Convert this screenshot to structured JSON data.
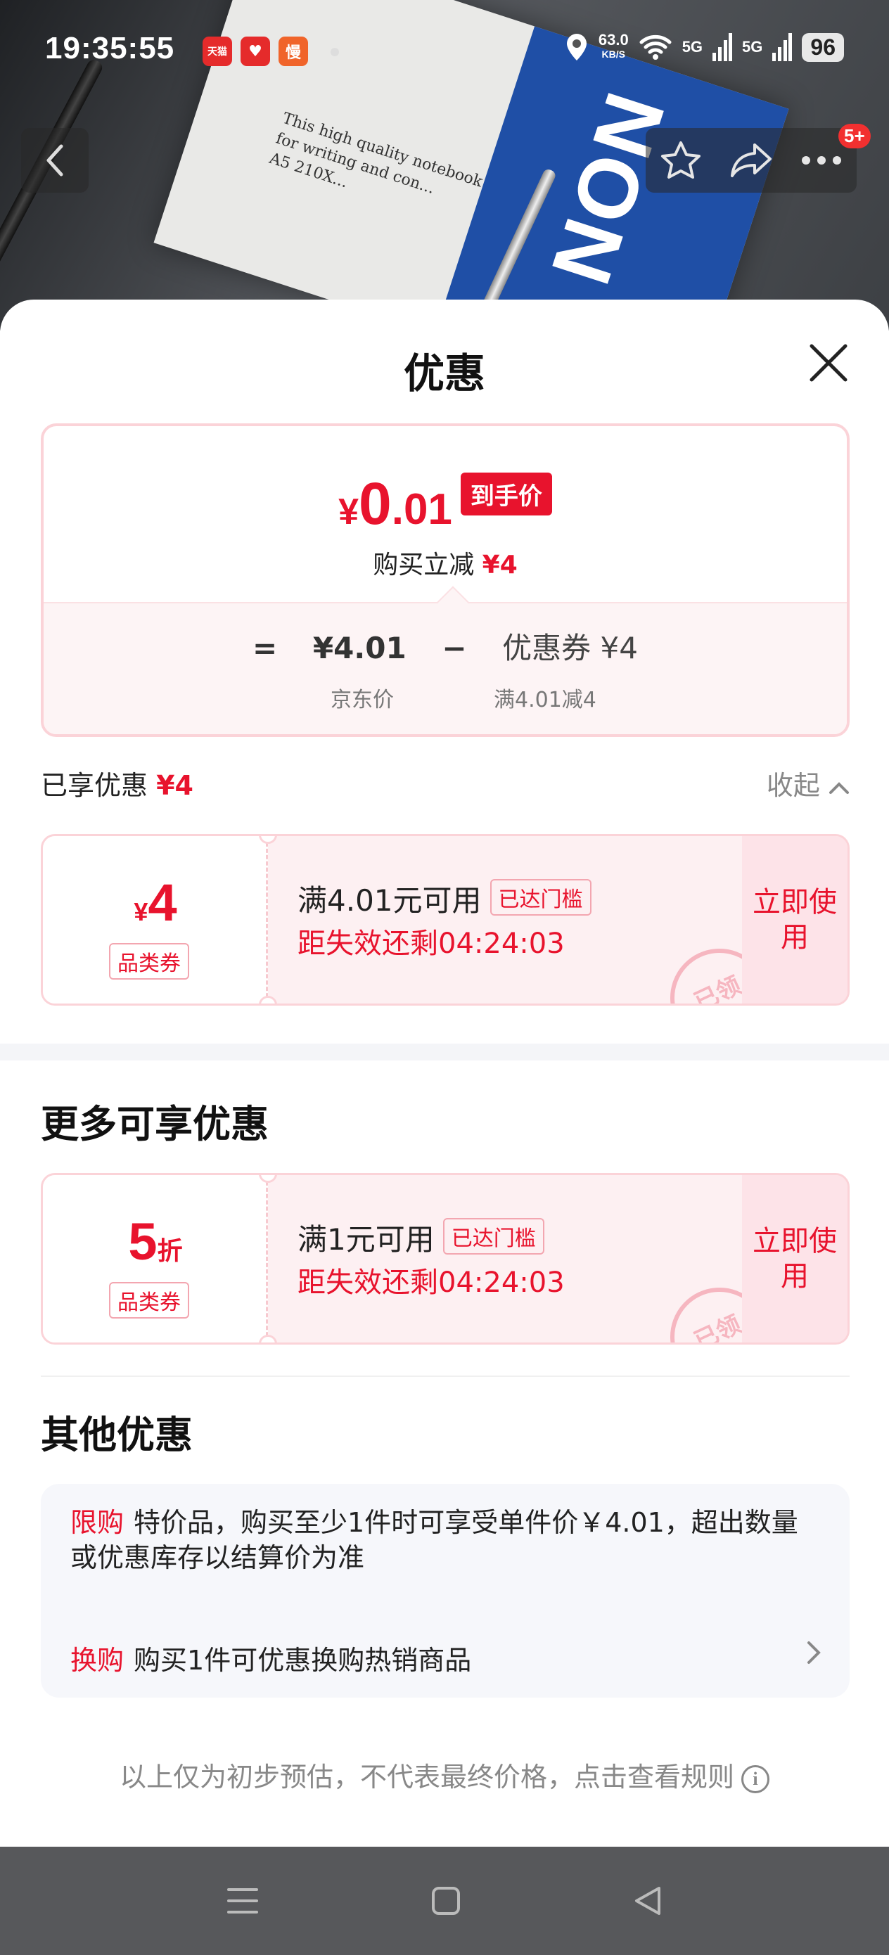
{
  "status_bar": {
    "time": "19:35:55",
    "app_icons": [
      "天猫",
      "♥",
      "慢"
    ],
    "net_speed_value": "63.0",
    "net_speed_unit": "KB/S",
    "signal1": "5G",
    "signal2": "5G",
    "battery": "96"
  },
  "photo": {
    "notebook_text_1": "This high quality notebook",
    "notebook_text_2": "for writing and con...",
    "notebook_text_3": "A5  210X...",
    "brand_text": "NON"
  },
  "top_nav": {
    "badge": "5+"
  },
  "sheet": {
    "title": "优惠"
  },
  "price_card": {
    "currency": "¥",
    "price_int": "0",
    "price_dec": ".01",
    "final_tag": "到手价",
    "instant_label": "购买立减",
    "instant_amount": "¥4",
    "eq": "=",
    "jd_price": "¥4.01",
    "minus": "−",
    "coupon_part": "优惠券 ¥4",
    "jd_price_label": "京东价",
    "coupon_rule": "满4.01减4"
  },
  "enjoyed": {
    "label": "已享优惠",
    "amount": "¥4",
    "collapse": "收起"
  },
  "coupon1": {
    "currency": "¥",
    "amount": "4",
    "suffix": "",
    "type": "品类券",
    "condition": "满4.01元可用",
    "threshold_tag": "已达门槛",
    "expire": "距失效还剩04:24:03",
    "use_label": "立即使用",
    "stamp": "已领"
  },
  "more_section": {
    "title": "更多可享优惠"
  },
  "coupon2": {
    "currency": "",
    "amount": "5",
    "suffix": "折",
    "type": "品类券",
    "condition": "满1元可用",
    "threshold_tag": "已达门槛",
    "expire": "距失效还剩04:24:03",
    "use_label": "立即使用",
    "stamp": "已领"
  },
  "other_section": {
    "title": "其他优惠",
    "row1_key": "限购",
    "row1_text": "特价品，购买至少1件时可享受单件价￥4.01，超出数量或优惠库存以结算价为准",
    "row2_key": "换购",
    "row2_text": "购买1件可优惠换购热销商品"
  },
  "footnote": "以上仅为初步预估，不代表最终价格，点击查看规则",
  "colors": {
    "accent_red": "#e8132d",
    "nav_bar": "#57585b"
  }
}
